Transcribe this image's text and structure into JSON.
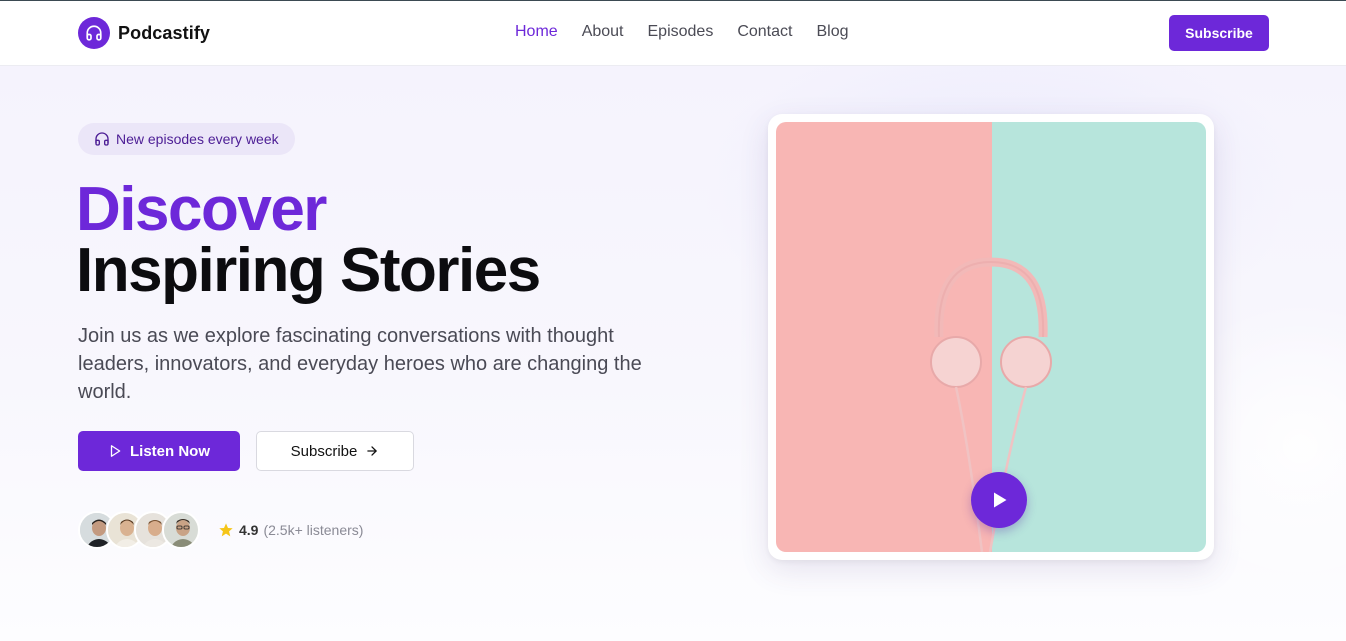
{
  "brand": {
    "name": "Podcastify",
    "logo_icon": "headphones-icon",
    "accent": "#6d28d9"
  },
  "nav": {
    "items": [
      {
        "label": "Home",
        "active": true
      },
      {
        "label": "About",
        "active": false
      },
      {
        "label": "Episodes",
        "active": false
      },
      {
        "label": "Contact",
        "active": false
      },
      {
        "label": "Blog",
        "active": false
      }
    ],
    "cta_label": "Subscribe"
  },
  "hero": {
    "badge": {
      "icon": "headphones-icon",
      "label": "New episodes every week"
    },
    "title_line1": "Discover",
    "title_line2": "Inspiring Stories",
    "description": "Join us as we explore fascinating conversations with thought leaders, innovators, and everyday heroes who are changing the world.",
    "primary_button": {
      "icon": "play-icon",
      "label": "Listen Now"
    },
    "secondary_button": {
      "icon": "arrow-right-icon",
      "label": "Subscribe"
    },
    "rating": {
      "icon": "star-icon",
      "value": "4.9",
      "listeners": "(2.5k+ listeners)"
    },
    "avatar_count": 4
  },
  "media": {
    "image": "headphones-on-pink-and-mint-background",
    "play_icon": "play-icon",
    "colors": {
      "left": "#f9b5b5",
      "right": "#b5e4dc"
    }
  }
}
